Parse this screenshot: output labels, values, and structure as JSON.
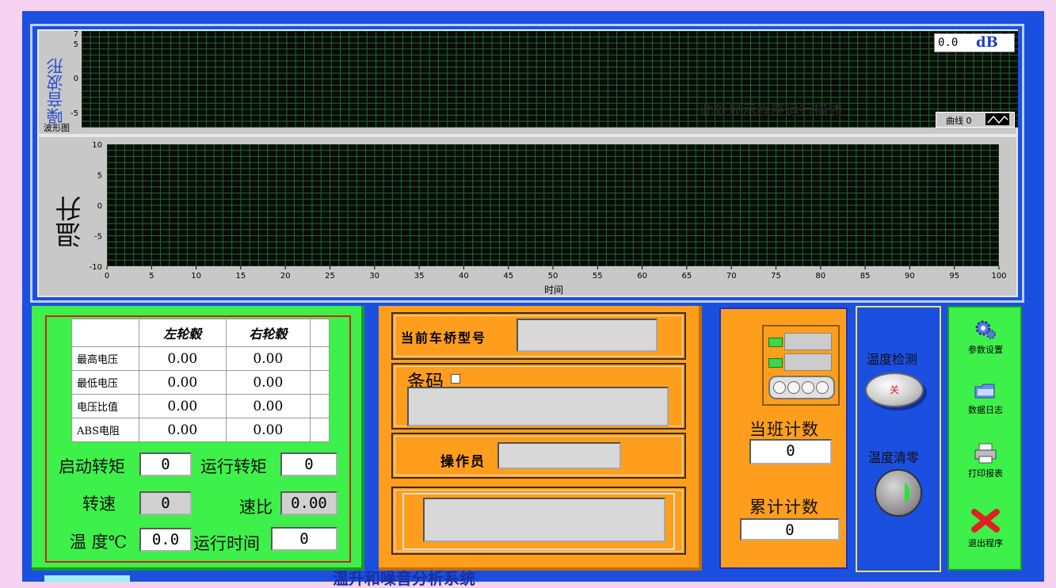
{
  "graph1": {
    "title": "噪音波形",
    "sub_label": "波形图",
    "y_ticks": [
      "7",
      "5",
      "0",
      "-5"
    ],
    "y_range": [
      -7,
      7
    ],
    "readout_value": "0.0",
    "readout_unit": "dB",
    "legend_label": "曲线 0",
    "watermark": "此处显示程序运行描述"
  },
  "graph2": {
    "title": "温升",
    "x_label": "时间",
    "y_ticks": [
      "10",
      "5",
      "0",
      "-5",
      "-10"
    ],
    "x_ticks": [
      "0",
      "5",
      "10",
      "15",
      "20",
      "25",
      "30",
      "35",
      "40",
      "45",
      "50",
      "55",
      "60",
      "65",
      "70",
      "75",
      "80",
      "85",
      "90",
      "95",
      "100"
    ],
    "x_range": [
      0,
      100
    ],
    "y_range": [
      -10,
      10
    ]
  },
  "table": {
    "headers": [
      "",
      "左轮毂",
      "右轮毂",
      ""
    ],
    "rows": [
      {
        "label": "最高电压",
        "left": "0.00",
        "right": "0.00"
      },
      {
        "label": "最低电压",
        "left": "0.00",
        "right": "0.00"
      },
      {
        "label": "电压比值",
        "left": "0.00",
        "right": "0.00"
      },
      {
        "label": "ABS电阻",
        "left": "0.00",
        "right": "0.00"
      }
    ]
  },
  "metrics": {
    "start_torque_label": "启动转矩",
    "start_torque": "0",
    "run_torque_label": "运行转矩",
    "run_torque": "0",
    "speed_label": "转速",
    "speed": "0",
    "ratio_label": "速比",
    "ratio": "0.00",
    "temp_label": "温 度℃",
    "temp": "0.0",
    "runtime_label": "运行时间",
    "runtime": "0"
  },
  "middle": {
    "axle_model_label": "当前车桥型号",
    "axle_model_value": "",
    "barcode_label": "条码",
    "barcode_value": "",
    "operator_label": "操作员",
    "operator_value": "",
    "message_value": ""
  },
  "counts": {
    "shift_label": "当班计数",
    "shift_value": "0",
    "total_label": "累计计数",
    "total_value": "0"
  },
  "temperature": {
    "detect_label": "温度检测",
    "detect_switch": "关",
    "zero_label": "温度清零"
  },
  "toolbar": {
    "settings": "参数设置",
    "log": "数据日志",
    "print": "打印报表",
    "exit": "退出程序"
  },
  "colors": {
    "frame_blue": "#1a4fe0",
    "green_panel": "#3ef04a",
    "orange_panel": "#ff9e1c",
    "plot_bg": "#0a0a0a",
    "grid_green": "#1e6b2a",
    "alarm_red": "#d42020"
  },
  "footer_text": "温升和噪音分析系统"
}
